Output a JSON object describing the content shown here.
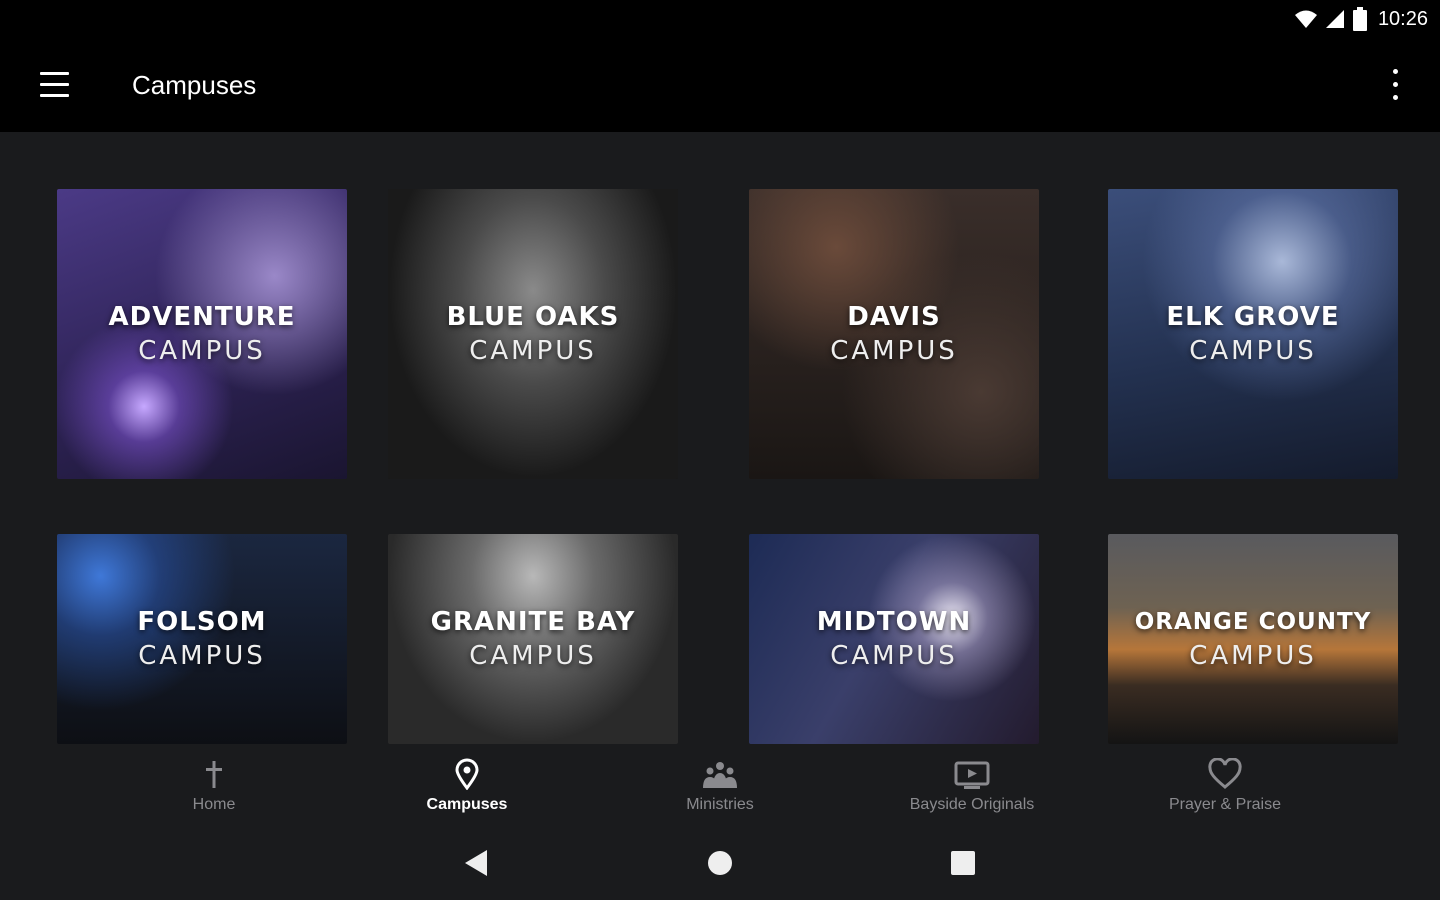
{
  "status_bar": {
    "time": "10:26",
    "icons": [
      "wifi-icon",
      "cell-signal-icon",
      "battery-icon"
    ]
  },
  "app_bar": {
    "title": "Campuses",
    "left_icon": "hamburger-menu-icon",
    "right_icon": "more-vert-icon"
  },
  "campuses": [
    {
      "name": "ADVENTURE",
      "sub": "CAMPUS"
    },
    {
      "name": "BLUE OAKS",
      "sub": "CAMPUS"
    },
    {
      "name": "DAVIS",
      "sub": "CAMPUS"
    },
    {
      "name": "ELK GROVE",
      "sub": "CAMPUS"
    },
    {
      "name": "FOLSOM",
      "sub": "CAMPUS"
    },
    {
      "name": "GRANITE BAY",
      "sub": "CAMPUS"
    },
    {
      "name": "MIDTOWN",
      "sub": "CAMPUS"
    },
    {
      "name": "ORANGE COUNTY",
      "sub": "CAMPUS"
    }
  ],
  "bottom_nav": [
    {
      "label": "Home",
      "icon": "cross-icon",
      "active": false
    },
    {
      "label": "Campuses",
      "icon": "location-pin-icon",
      "active": true
    },
    {
      "label": "Ministries",
      "icon": "people-group-icon",
      "active": false
    },
    {
      "label": "Bayside Originals",
      "icon": "tv-play-icon",
      "active": false
    },
    {
      "label": "Prayer & Praise",
      "icon": "heart-icon",
      "active": false
    }
  ],
  "system_nav": {
    "icons": [
      "back-triangle-icon",
      "home-circle-icon",
      "recents-square-icon"
    ]
  },
  "colors": {
    "background": "#1a1b1d",
    "app_bar": "#000000",
    "nav_inactive": "#8a8a8e",
    "nav_active": "#ffffff"
  }
}
